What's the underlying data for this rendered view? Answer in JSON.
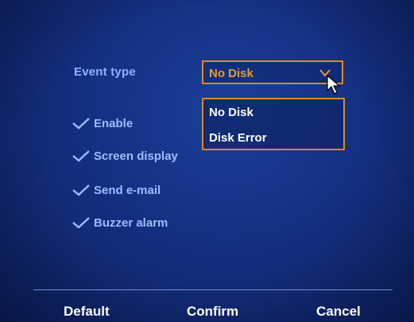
{
  "event_type": {
    "label": "Event type",
    "selected": "No Disk",
    "options": [
      "No Disk",
      "Disk Error"
    ]
  },
  "checkboxes": [
    {
      "label": "Enable",
      "checked": true
    },
    {
      "label": "Screen display",
      "checked": true
    },
    {
      "label": "Send e-mail",
      "checked": true
    },
    {
      "label": "Buzzer alarm",
      "checked": true
    }
  ],
  "buttons": {
    "default": "Default",
    "confirm": "Confirm",
    "cancel": "Cancel"
  },
  "colors": {
    "background": "#142f80",
    "label": "#8fb2ff",
    "accent": "#d98a2b",
    "selected_value": "#e79b36",
    "text": "#ffffff"
  },
  "icons": [
    "check-icon",
    "chevron-down-icon",
    "mouse-cursor-icon"
  ]
}
